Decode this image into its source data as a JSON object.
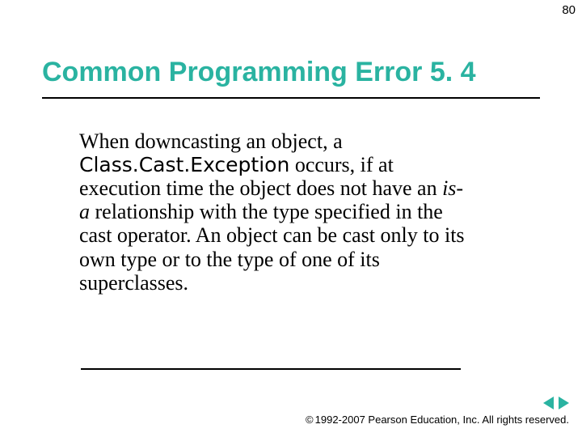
{
  "page_number": "80",
  "title": "Common Programming Error 5. 4",
  "body": {
    "pre_code": "When downcasting an object, a ",
    "code": "Class.Cast.Exception",
    "mid1": " occurs, if at execution time the object does not have an ",
    "isa": "is-a",
    "mid2": " relationship with the type specified in the cast operator. An object can be cast only to its own type or to the type of one of its superclasses."
  },
  "footer": {
    "copyright_symbol": "©",
    "text": " 1992-2007 Pearson Education, Inc. All rights reserved."
  },
  "colors": {
    "accent": "#2ab3a1"
  }
}
